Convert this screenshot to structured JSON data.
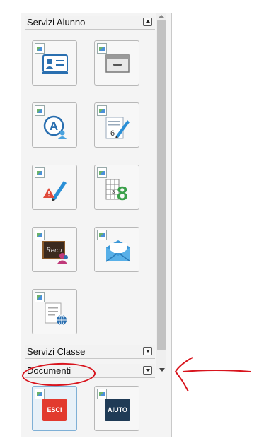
{
  "sections": {
    "servizi_alunno": {
      "label": "Servizi Alunno"
    },
    "servizi_classe": {
      "label": "Servizi Classe"
    },
    "documenti": {
      "label": "Documenti"
    }
  },
  "tiles": {
    "anagrafica": {
      "icon": "id-card-icon"
    },
    "archivio": {
      "icon": "drawer-icon"
    },
    "assenze": {
      "icon": "user-a-icon"
    },
    "voti": {
      "icon": "grade-pencil-icon"
    },
    "note": {
      "icon": "warning-pencil-icon"
    },
    "pagella": {
      "icon": "grid-8-icon"
    },
    "recupero": {
      "icon": "recovery-board-icon"
    },
    "messaggi": {
      "icon": "envelope-icon"
    },
    "web": {
      "icon": "document-globe-icon"
    }
  },
  "footer_buttons": {
    "esci": {
      "label": "ESCI",
      "color": "#e23a2e"
    },
    "aiuto": {
      "label": "AIUTO",
      "color": "#1f3b56"
    }
  },
  "annotation": {
    "color": "#d8141d"
  }
}
